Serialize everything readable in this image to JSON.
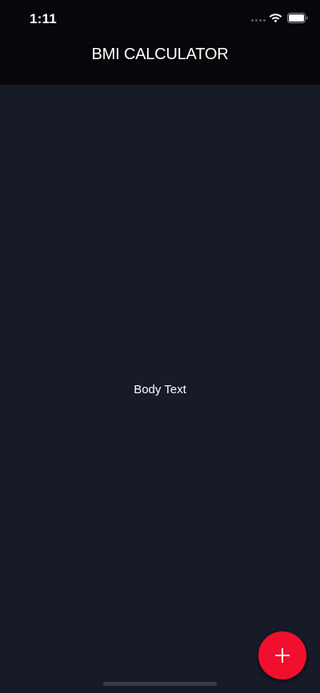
{
  "status_bar": {
    "time": "1:11",
    "icons": [
      "signal-dots-icon",
      "wifi-icon",
      "battery-icon"
    ]
  },
  "app_bar": {
    "title": "BMI CALCULATOR"
  },
  "main": {
    "body_text": "Body Text"
  },
  "fab": {
    "icon": "plus-icon",
    "color": "#f0102e"
  },
  "colors": {
    "app_bar_background": "#07070b",
    "body_background": "#171a27",
    "text": "#ffffff"
  }
}
